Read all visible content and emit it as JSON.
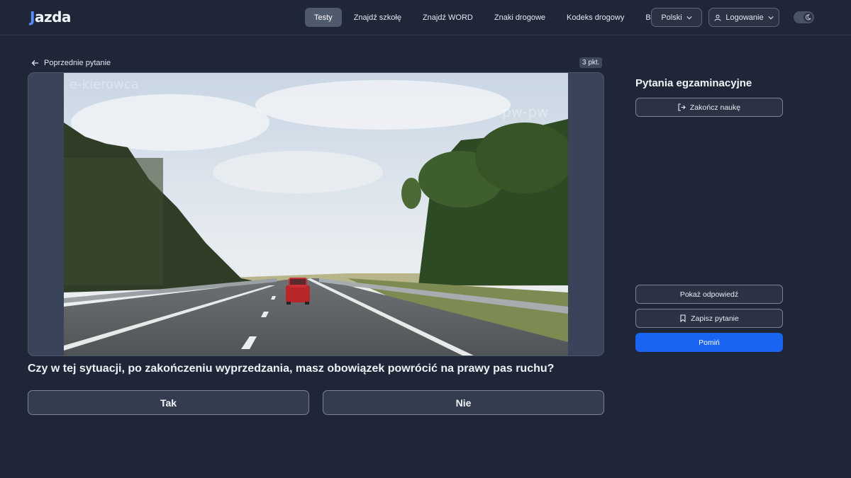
{
  "header": {
    "logo": "Jazda",
    "nav": [
      {
        "label": "Testy",
        "active": true
      },
      {
        "label": "Znajdź szkołę",
        "active": false
      },
      {
        "label": "Znajdź WORD",
        "active": false
      },
      {
        "label": "Znaki drogowe",
        "active": false
      },
      {
        "label": "Kodeks drogowy",
        "active": false
      },
      {
        "label": "Blog",
        "active": false
      }
    ],
    "language_label": "Polski",
    "login_label": "Logowanie",
    "theme_toggle_icon": "moon-icon"
  },
  "main": {
    "back_label": "Poprzednie pytanie",
    "points_label": "3 pkt.",
    "media": {
      "watermark_left": "e-kierowca",
      "watermark_right": "pw-pw"
    },
    "question": "Czy w tej sytuacji, po zakończeniu wyprzedzania, masz obowiązek powrócić na prawy pas ruchu?",
    "answers": [
      "Tak",
      "Nie"
    ]
  },
  "sidebar": {
    "title": "Pytania egzaminacyjne",
    "finish_label": "Zakończ naukę",
    "show_answer_label": "Pokaż odpowiedź",
    "save_label": "Zapisz pytanie",
    "skip_label": "Pomiń"
  },
  "colors": {
    "background": "#1f2637",
    "accent": "#1a64f2",
    "nav_active": "#4f5a6e"
  }
}
